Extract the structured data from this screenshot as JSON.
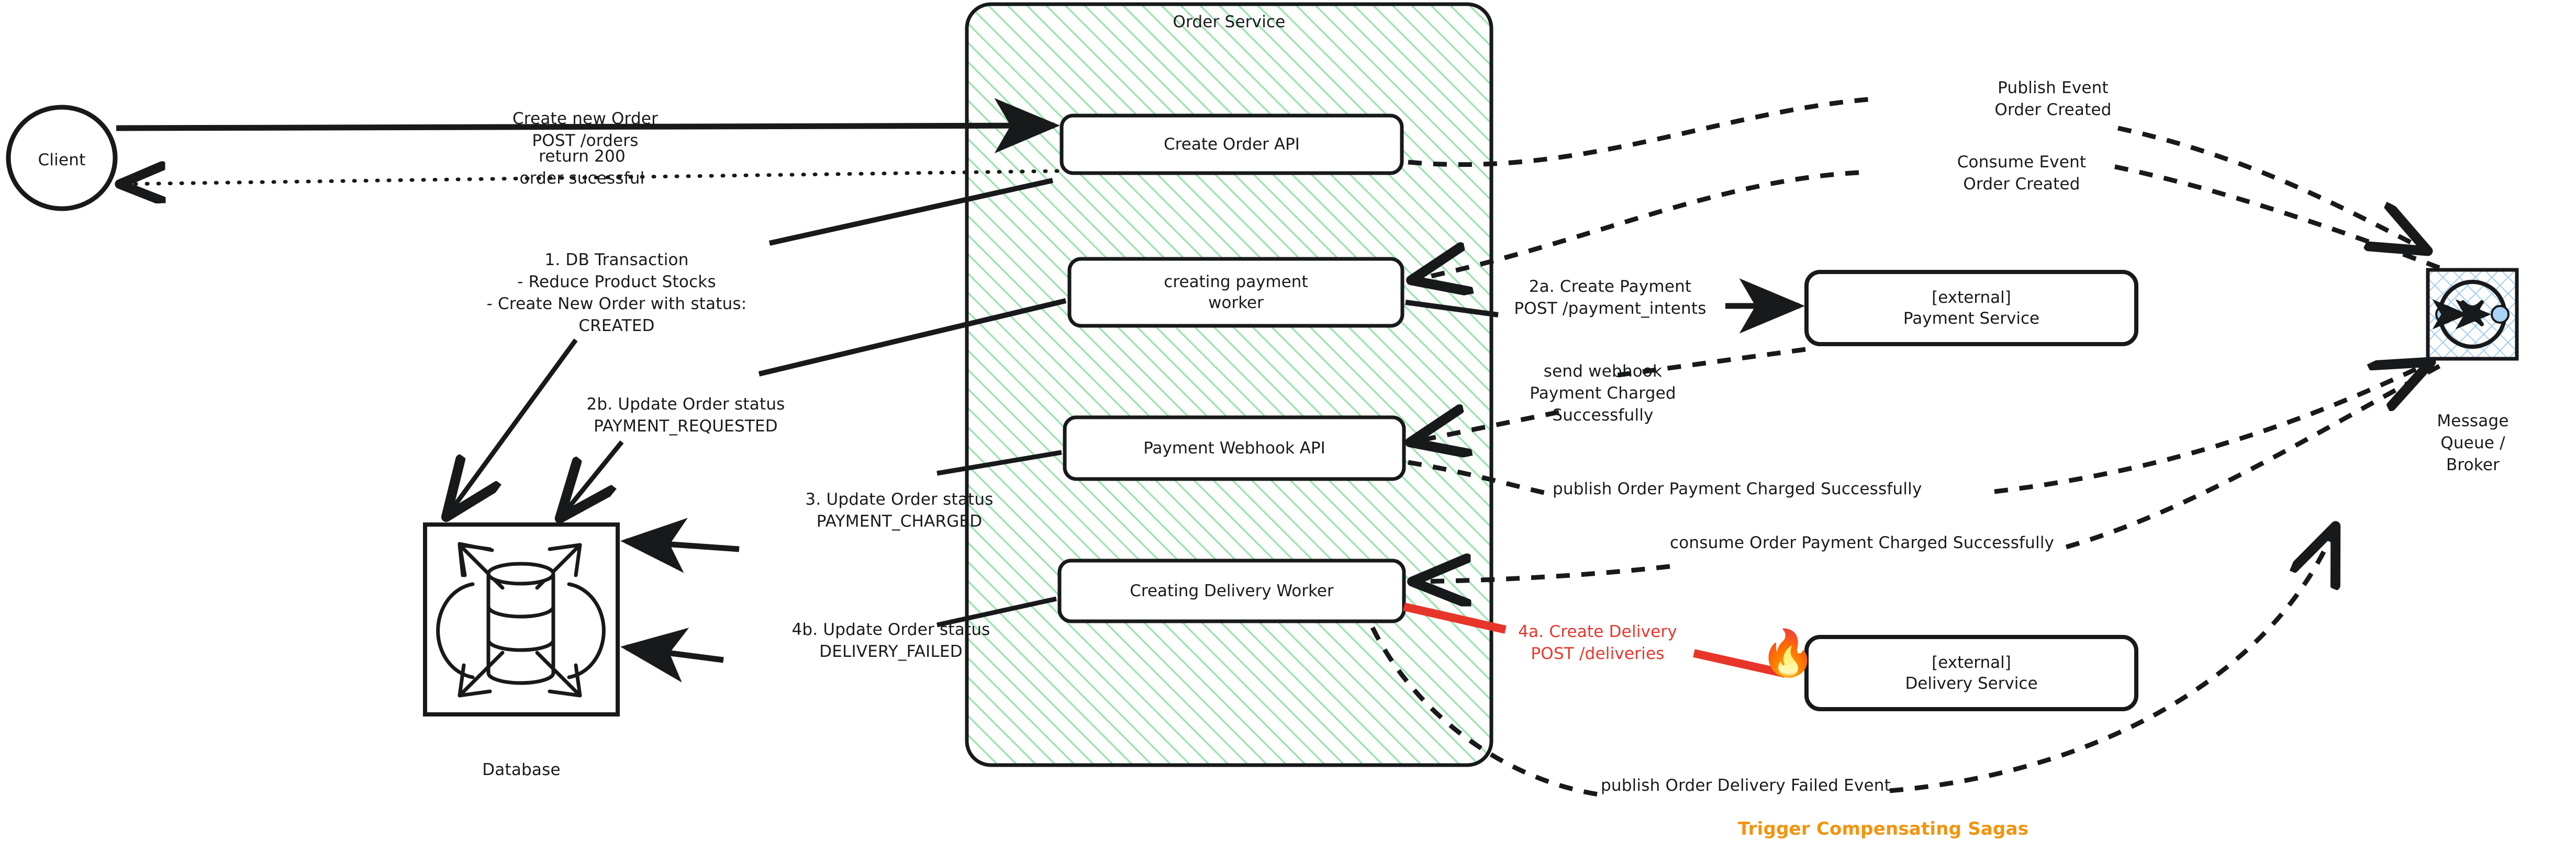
{
  "diagram": {
    "title_note": "Order Service saga / choreography architecture diagram"
  },
  "nodes": {
    "client": {
      "label": "Client"
    },
    "order_service": {
      "label": "Order Service"
    },
    "create_order_api": {
      "label": "Create Order API"
    },
    "creating_payment_worker": {
      "label": "creating payment\nworker"
    },
    "payment_webhook_api": {
      "label": "Payment Webhook API"
    },
    "creating_delivery_worker": {
      "label": "Creating Delivery Worker"
    },
    "payment_service": {
      "label": "[external]\nPayment Service"
    },
    "delivery_service": {
      "label": "[external]\nDelivery Service"
    },
    "database": {
      "label": "Database"
    },
    "message_queue": {
      "label": "Message\nQueue / Broker"
    }
  },
  "edge_labels": {
    "create_new_order": "Create new Order\nPOST /orders",
    "return_200": "return 200\norder sucessful",
    "db_transaction": "1. DB Transaction\n- Reduce Product Stocks\n- Create New Order with status:\nCREATED",
    "update_payment_requested": "2b. Update Order status\nPAYMENT_REQUESTED",
    "update_payment_charged": "3. Update Order status\nPAYMENT_CHARGED",
    "update_delivery_failed": "4b. Update Order status\nDELIVERY_FAILED",
    "create_payment": "2a. Create Payment\nPOST /payment_intents",
    "send_webhook": "send webhook\nPayment Charged\nSuccessfully",
    "create_delivery": "4a. Create Delivery\nPOST /deliveries",
    "publish_order_created": "Publish Event\nOrder Created",
    "consume_order_created": "Consume Event\nOrder Created",
    "publish_payment_charged": "publish Order Payment Charged Successfully",
    "consume_payment_charged": "consume Order Payment Charged Successfully",
    "publish_delivery_failed": "publish Order Delivery Failed Event"
  },
  "annotations": {
    "trigger_sagas": "Trigger Compensating Sagas"
  },
  "icons": {
    "database": "database-cylinder-icon",
    "message_queue": "message-queue-icon",
    "failure": "fire-emoji-icon"
  },
  "colors": {
    "ink": "#18191a",
    "service_hatch": "#98e0ac",
    "mq_hatch": "#9ecbf0",
    "mq_dot": "#a9d4f5",
    "error_red": "#e8352a",
    "saga_orange": "#f2940d",
    "background": "#ffffff"
  }
}
